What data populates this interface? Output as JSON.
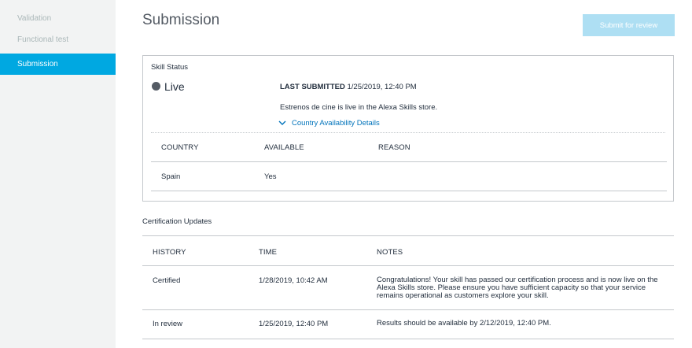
{
  "sidebar": {
    "items": [
      {
        "label": "Validation",
        "active": false
      },
      {
        "label": "Functional test",
        "active": false
      },
      {
        "label": "Submission",
        "active": true
      }
    ]
  },
  "header": {
    "title": "Submission",
    "submit_label": "Submit for review"
  },
  "skill_status": {
    "section_title": "Skill Status",
    "status": "Live",
    "last_submitted_label": "LAST SUBMITTED",
    "last_submitted_value": "1/25/2019, 12:40 PM",
    "message": "Estrenos de cine is live in the Alexa Skills store.",
    "country_link": "Country Availability Details",
    "country_table": {
      "headers": [
        "COUNTRY",
        "AVAILABLE",
        "REASON"
      ],
      "rows": [
        {
          "country": "Spain",
          "available": "Yes",
          "reason": ""
        }
      ]
    }
  },
  "certification": {
    "section_title": "Certification Updates",
    "headers": [
      "HISTORY",
      "TIME",
      "NOTES"
    ],
    "rows": [
      {
        "history": "Certified",
        "time": "1/28/2019, 10:42 AM",
        "notes": "Congratulations! Your skill has passed our certification process and is now live on the Alexa Skills store. Please ensure you have sufficient capacity so that your service remains operational as customers explore your skill."
      },
      {
        "history": "In review",
        "time": "1/25/2019, 12:40 PM",
        "notes": "Results should be available by 2/12/2019, 12:40 PM."
      }
    ]
  },
  "colors": {
    "accent": "#00a8e1",
    "link": "#0073bb",
    "button_disabled": "#aedff3",
    "sidebar_bg": "#f2f3f3",
    "status_dot": "#545b64"
  },
  "icons": {
    "country_link_icon": "chevron-down-icon",
    "status_icon": "status-dot-icon"
  }
}
